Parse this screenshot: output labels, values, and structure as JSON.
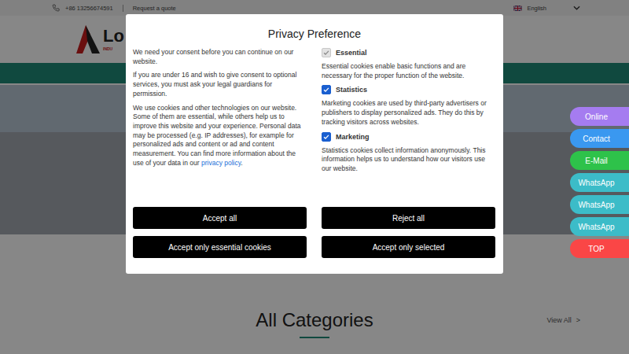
{
  "topbar": {
    "phone": "+86 13256674591",
    "quote": "Request a quote",
    "language": "English"
  },
  "logo": {
    "name": "Lo",
    "tagline": "INDU"
  },
  "section": {
    "title": "All Categories",
    "link": "View All",
    "link_icon": ">"
  },
  "floating": [
    {
      "label": "Online",
      "color": "#a57cf0"
    },
    {
      "label": "Contact",
      "color": "#3a98f0"
    },
    {
      "label": "E-Mail",
      "color": "#2ec24a"
    },
    {
      "label": "WhatsApp",
      "color": "#3cbcc8"
    },
    {
      "label": "WhatsApp",
      "color": "#3cbcc8"
    },
    {
      "label": "WhatsApp",
      "color": "#3cbcc8"
    },
    {
      "label": "TOP",
      "color": "#fa4646"
    }
  ],
  "modal": {
    "title": "Privacy Preference",
    "intro": "We need your consent before you can continue on our website.",
    "minors": "If you are under 16 and wish to give consent to optional services, you must ask your legal guardians for permission.",
    "details": {
      "before": "We use cookies and other technologies on our website. Some of them are essential, while others help us to improve this website and your experience. Personal data may be processed (e.g. IP addresses), for example for personalized ads and content or ad and content measurement. You can find more information about the use of your data in our ",
      "link": "privacy policy",
      "after": "."
    },
    "options": [
      {
        "label": "Essential",
        "description": "Essential cookies enable basic functions and are necessary for the proper function of the website.",
        "checked": true,
        "disabled": true
      },
      {
        "label": "Statistics",
        "description": "Marketing cookies are used by third-party advertisers or publishers to display personalized ads. They do this by tracking visitors across websites.",
        "checked": true,
        "disabled": false
      },
      {
        "label": "Marketing",
        "description": "Statistics cookies collect information anonymously. This information helps us to understand how our visitors use our website.",
        "checked": true,
        "disabled": false
      }
    ],
    "buttons": [
      "Accept all",
      "Reject all",
      "Accept only essential cookies",
      "Accept only selected"
    ]
  }
}
